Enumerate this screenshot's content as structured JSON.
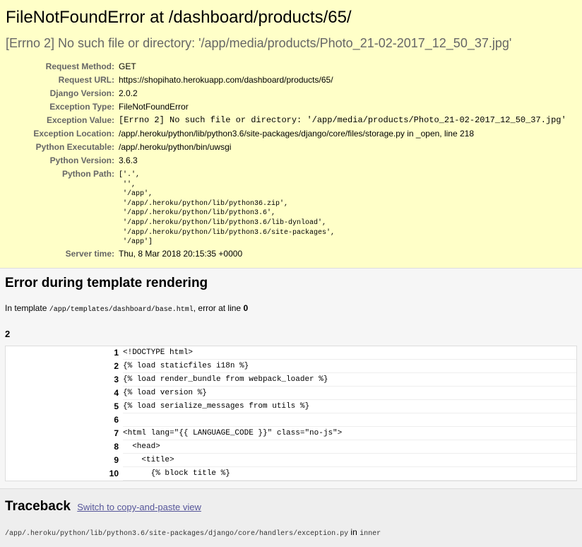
{
  "summary": {
    "title": "FileNotFoundError at /dashboard/products/65/",
    "exception_message": "[Errno 2] No such file or directory: '/app/media/products/Photo_21-02-2017_12_50_37.jpg'",
    "meta": [
      {
        "label": "Request Method:",
        "value": "GET"
      },
      {
        "label": "Request URL:",
        "value": "https://shopihato.herokuapp.com/dashboard/products/65/"
      },
      {
        "label": "Django Version:",
        "value": "2.0.2"
      },
      {
        "label": "Exception Type:",
        "value": "FileNotFoundError"
      },
      {
        "label": "Exception Value:",
        "value": "[Errno 2] No such file or directory: '/app/media/products/Photo_21-02-2017_12_50_37.jpg'"
      },
      {
        "label": "Exception Location:",
        "value": "/app/.heroku/python/lib/python3.6/site-packages/django/core/files/storage.py in _open, line 218"
      },
      {
        "label": "Python Executable:",
        "value": "/app/.heroku/python/bin/uwsgi"
      },
      {
        "label": "Python Version:",
        "value": "3.6.3"
      },
      {
        "label": "Python Path:",
        "value": "['.',\n '',\n '/app',\n '/app/.heroku/python/lib/python36.zip',\n '/app/.heroku/python/lib/python3.6',\n '/app/.heroku/python/lib/python3.6/lib-dynload',\n '/app/.heroku/python/lib/python3.6/site-packages',\n '/app']"
      },
      {
        "label": "Server time:",
        "value": "Thu, 8 Mar 2018 20:15:35 +0000"
      }
    ]
  },
  "template": {
    "heading": "Error during template rendering",
    "intro_prefix": "In template ",
    "template_path": "/app/templates/dashboard/base.html",
    "intro_suffix": ", error at line ",
    "error_line": "0",
    "error_value": "2",
    "lines": [
      {
        "num": "1",
        "code": "<!DOCTYPE html>"
      },
      {
        "num": "2",
        "code": "{% load staticfiles i18n %}"
      },
      {
        "num": "3",
        "code": "{% load render_bundle from webpack_loader %}"
      },
      {
        "num": "4",
        "code": "{% load version %}"
      },
      {
        "num": "5",
        "code": "{% load serialize_messages from utils %}"
      },
      {
        "num": "6",
        "code": ""
      },
      {
        "num": "7",
        "code": "<html lang=\"{{ LANGUAGE_CODE }}\" class=\"no-js\">"
      },
      {
        "num": "8",
        "code": "  <head>"
      },
      {
        "num": "9",
        "code": "    <title>"
      },
      {
        "num": "10",
        "code": "      {% block title %}"
      }
    ]
  },
  "traceback": {
    "heading": "Traceback",
    "switch_link": "Switch to copy-and-paste view",
    "frame_file": "/app/.heroku/python/lib/python3.6/site-packages/django/core/handlers/exception.py",
    "frame_in": " in ",
    "frame_func": "inner"
  }
}
